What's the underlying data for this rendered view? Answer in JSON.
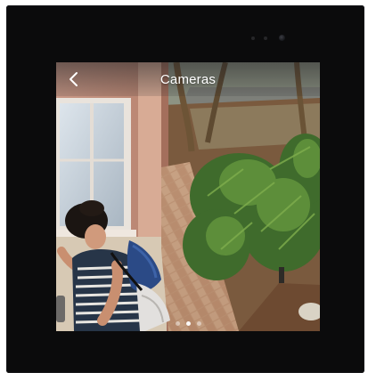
{
  "header": {
    "title": "Cameras",
    "back_icon": "chevron-left-icon"
  },
  "pager": {
    "count": 3,
    "active_index": 1
  },
  "colors": {
    "bezel": "#0b0b0c",
    "header_text": "#ffffff"
  }
}
